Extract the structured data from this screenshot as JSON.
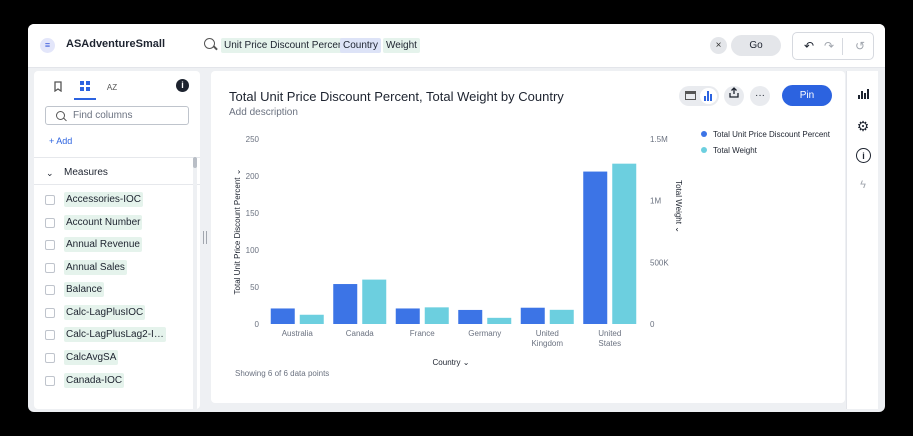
{
  "datasource": {
    "name": "ASAdventureSmall",
    "icon": "database-icon"
  },
  "search": {
    "tokens": [
      "Unit Price Discount Percent",
      "Country",
      "Weight"
    ],
    "clear": "×",
    "go": "Go"
  },
  "history": {
    "undo": "↶",
    "redo": "↷",
    "reset": "↺"
  },
  "left_panel": {
    "tabs": [
      "bookmark-icon",
      "grid-icon",
      "sort-az-icon"
    ],
    "az_label": "AZ",
    "info": "i",
    "find_placeholder": "Find columns",
    "add_label": "+ Add",
    "section": "Measures",
    "columns": [
      "Accessories-IOC",
      "Account Number",
      "Annual Revenue",
      "Annual Sales",
      "Balance",
      "Calc-LagPlusIOC",
      "Calc-LagPlusLag2-I…",
      "CalcAvgSA",
      "Canada-IOC"
    ]
  },
  "card": {
    "title": "Total Unit Price Discount Percent, Total Weight by Country",
    "description": "Add description",
    "pin": "Pin",
    "more": "···",
    "footer": "Showing 6 of 6 data points"
  },
  "colors": {
    "accent": "#2c63e0",
    "series1": "#3c74e6",
    "series2": "#6ccfdf"
  },
  "chart_data": {
    "type": "bar",
    "categories": [
      "Australia",
      "Canada",
      "France",
      "Germany",
      "United Kingdom",
      "United States"
    ],
    "category_lines": [
      [
        "Australia"
      ],
      [
        "Canada"
      ],
      [
        "France"
      ],
      [
        "Germany"
      ],
      [
        "United",
        "Kingdom"
      ],
      [
        "United",
        "States"
      ]
    ],
    "series": [
      {
        "name": "Total Unit Price Discount Percent",
        "axis": "left",
        "values": [
          21,
          54,
          21,
          19,
          22,
          206
        ]
      },
      {
        "name": "Total Weight",
        "axis": "right",
        "values": [
          75000,
          360000,
          135000,
          50000,
          115000,
          1300000
        ]
      }
    ],
    "xlabel": "Country",
    "ylabel": "Total Unit Price Discount Percent",
    "y2label": "Total Weight",
    "ylim": [
      0,
      250
    ],
    "yticks": [
      0,
      50,
      100,
      150,
      200,
      250
    ],
    "y2lim": [
      0,
      1500000
    ],
    "y2ticks": [
      0,
      500000,
      1000000,
      1500000
    ],
    "y2tick_labels": [
      "0",
      "500K",
      "1M",
      "1.5M"
    ],
    "legend": "top-right",
    "grid": false
  },
  "rail": [
    "bar-chart-icon",
    "settings-icon",
    "info-icon",
    "bolt-icon"
  ]
}
